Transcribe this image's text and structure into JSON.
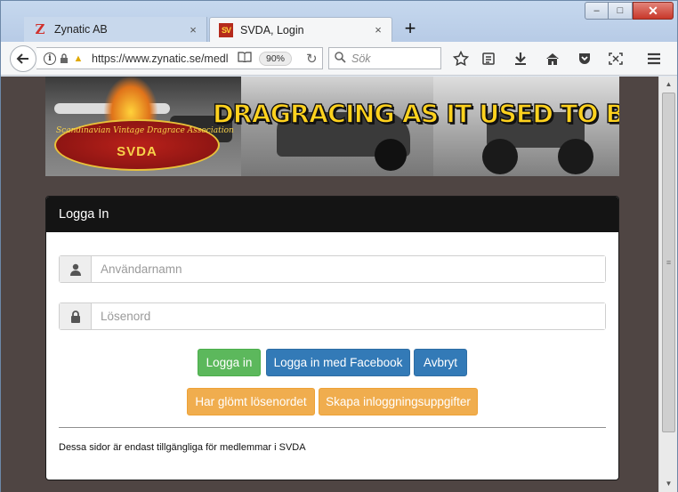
{
  "tabs": [
    {
      "title": "Zynatic AB",
      "favicon": "Z",
      "close": "×"
    },
    {
      "title": "SVDA, Login",
      "favicon": "SV",
      "close": "×"
    }
  ],
  "newtab": "+",
  "window": {
    "minimize": "–",
    "maximize": "□",
    "close": "✕"
  },
  "nav": {
    "url": "https://www.zynatic.se/medl",
    "zoom": "90%",
    "search_placeholder": "Sök"
  },
  "toolbar_icons": [
    "star-icon",
    "reading-list-icon",
    "download-icon",
    "home-icon",
    "pocket-icon",
    "screenshot-icon",
    "menu-icon"
  ],
  "banner": {
    "title": "DRAGRACING AS IT USED TO BE!",
    "logo_name": "Scandinavian Vintage Dragrace Association",
    "logo_abbr": "SVDA"
  },
  "card": {
    "heading": "Logga In",
    "username_placeholder": "Användarnamn",
    "password_placeholder": "Lösenord",
    "buttons": {
      "login": "Logga in",
      "facebook": "Logga in med Facebook",
      "cancel": "Avbryt",
      "forgot": "Har glömt lösenordet",
      "create": "Skapa inloggningsuppgifter"
    },
    "footnote": "Dessa sidor är endast tillgängliga för medlemmar i SVDA"
  },
  "colors": {
    "success": "#5cb85c",
    "primary": "#337ab7",
    "warning": "#f0ad4e",
    "page_bg": "#4f4543",
    "card_header": "#141414"
  }
}
